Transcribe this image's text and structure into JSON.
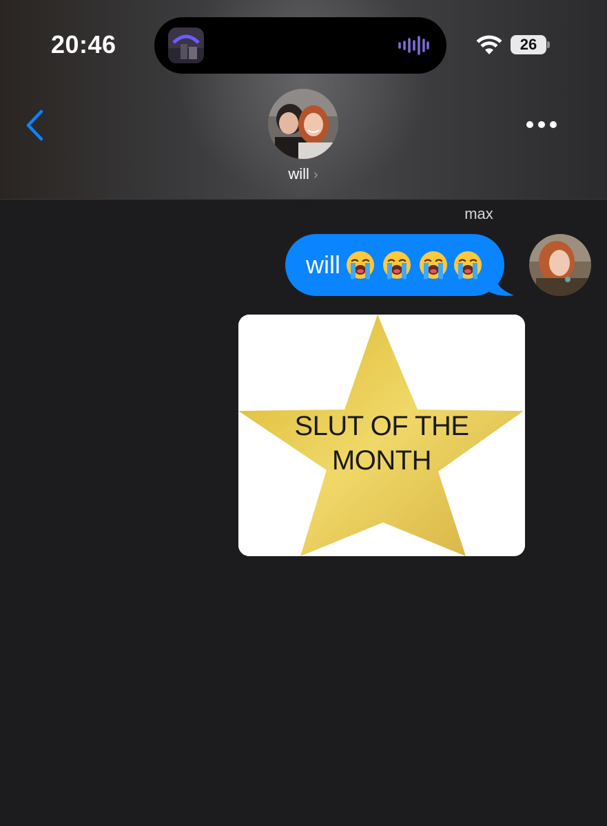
{
  "status_bar": {
    "time": "20:46",
    "battery_level": "26",
    "icons": [
      "wifi-icon",
      "battery-icon",
      "audio-waveform-icon"
    ]
  },
  "header": {
    "contact_name": "will",
    "chevron": "›",
    "icons": [
      "back-chevron-icon",
      "more-dots-icon"
    ]
  },
  "conversation": {
    "messages": [
      {
        "sender": "max",
        "text": "will",
        "emoji_count": 4,
        "emoji": "loudly-crying-face"
      },
      {
        "sender": "max",
        "type": "image",
        "image_text_line1": "SLUT OF THE",
        "image_text_line2": "MONTH"
      }
    ]
  },
  "colors": {
    "background": "#1c1c1e",
    "bubble": "#0a84ff",
    "accent": "#0a84ff",
    "star": "#e9c84a"
  }
}
